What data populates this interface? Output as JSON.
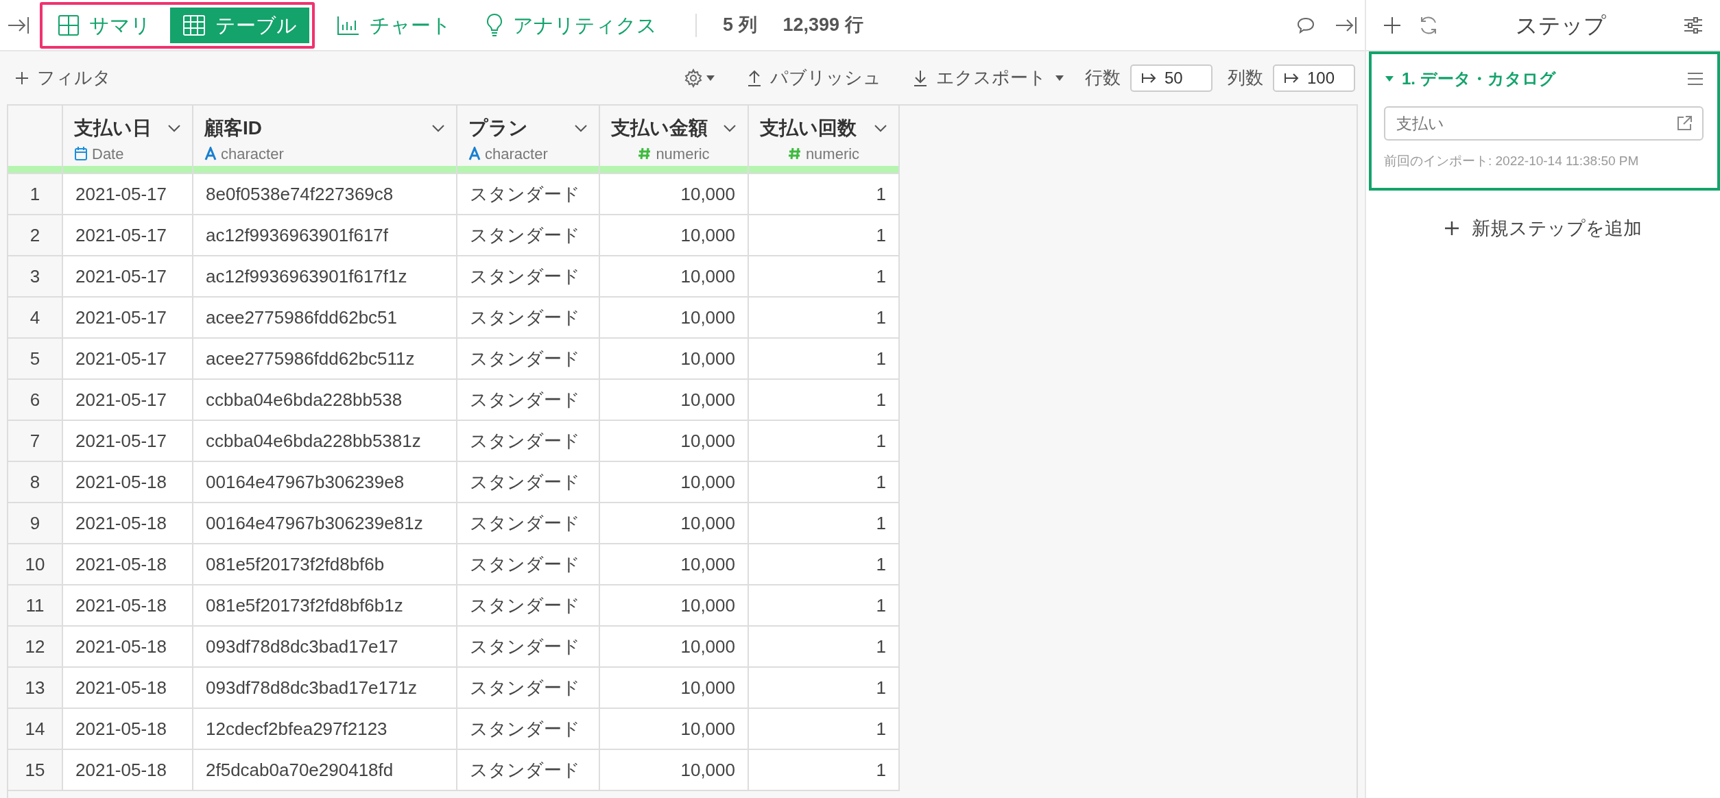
{
  "top_bar": {
    "tabs": [
      {
        "label": "サマリ",
        "selected": false
      },
      {
        "label": "テーブル",
        "selected": true
      },
      {
        "label": "チャート",
        "selected": false
      },
      {
        "label": "アナリティクス",
        "selected": false
      }
    ],
    "column_count": "5 列",
    "row_count": "12,399 行"
  },
  "toolbar": {
    "filter_button": "フィルタ",
    "publish_button": "パブリッシュ",
    "export_button": "エクスポート",
    "row_limit": {
      "label": "行数",
      "value": "50"
    },
    "column_limit": {
      "label": "列数",
      "value": "100"
    }
  },
  "table": {
    "columns": [
      {
        "name": "支払い日",
        "type": "Date",
        "kind": "date"
      },
      {
        "name": "顧客ID",
        "type": "character",
        "kind": "character"
      },
      {
        "name": "プラン",
        "type": "character",
        "kind": "character"
      },
      {
        "name": "支払い金額",
        "type": "numeric",
        "kind": "numeric"
      },
      {
        "name": "支払い回数",
        "type": "numeric",
        "kind": "numeric"
      }
    ],
    "rows": [
      {
        "number": "1",
        "cells": [
          "2021-05-17",
          "8e0f0538e74f227369c8",
          "スタンダード",
          "10,000",
          "1"
        ]
      },
      {
        "number": "2",
        "cells": [
          "2021-05-17",
          "ac12f9936963901f617f",
          "スタンダード",
          "10,000",
          "1"
        ]
      },
      {
        "number": "3",
        "cells": [
          "2021-05-17",
          "ac12f9936963901f617f1z",
          "スタンダード",
          "10,000",
          "1"
        ]
      },
      {
        "number": "4",
        "cells": [
          "2021-05-17",
          "acee2775986fdd62bc51",
          "スタンダード",
          "10,000",
          "1"
        ]
      },
      {
        "number": "5",
        "cells": [
          "2021-05-17",
          "acee2775986fdd62bc511z",
          "スタンダード",
          "10,000",
          "1"
        ]
      },
      {
        "number": "6",
        "cells": [
          "2021-05-17",
          "ccbba04e6bda228bb538",
          "スタンダード",
          "10,000",
          "1"
        ]
      },
      {
        "number": "7",
        "cells": [
          "2021-05-17",
          "ccbba04e6bda228bb5381z",
          "スタンダード",
          "10,000",
          "1"
        ]
      },
      {
        "number": "8",
        "cells": [
          "2021-05-18",
          "00164e47967b306239e8",
          "スタンダード",
          "10,000",
          "1"
        ]
      },
      {
        "number": "9",
        "cells": [
          "2021-05-18",
          "00164e47967b306239e81z",
          "スタンダード",
          "10,000",
          "1"
        ]
      },
      {
        "number": "10",
        "cells": [
          "2021-05-18",
          "081e5f20173f2fd8bf6b",
          "スタンダード",
          "10,000",
          "1"
        ]
      },
      {
        "number": "11",
        "cells": [
          "2021-05-18",
          "081e5f20173f2fd8bf6b1z",
          "スタンダード",
          "10,000",
          "1"
        ]
      },
      {
        "number": "12",
        "cells": [
          "2021-05-18",
          "093df78d8dc3bad17e17",
          "スタンダード",
          "10,000",
          "1"
        ]
      },
      {
        "number": "13",
        "cells": [
          "2021-05-18",
          "093df78d8dc3bad17e171z",
          "スタンダード",
          "10,000",
          "1"
        ]
      },
      {
        "number": "14",
        "cells": [
          "2021-05-18",
          "12cdecf2bfea297f2123",
          "スタンダード",
          "10,000",
          "1"
        ]
      },
      {
        "number": "15",
        "cells": [
          "2021-05-18",
          "2f5dcab0a70e290418fd",
          "スタンダード",
          "10,000",
          "1"
        ]
      }
    ]
  },
  "steps_panel": {
    "title": "ステップ",
    "steps": [
      {
        "title": "1. データ・カタログ",
        "expanded": true,
        "source": "支払い",
        "last_import": "前回のインポート: 2022-10-14 11:38:50 PM"
      }
    ],
    "add_step_button": "新規ステップを追加"
  }
}
